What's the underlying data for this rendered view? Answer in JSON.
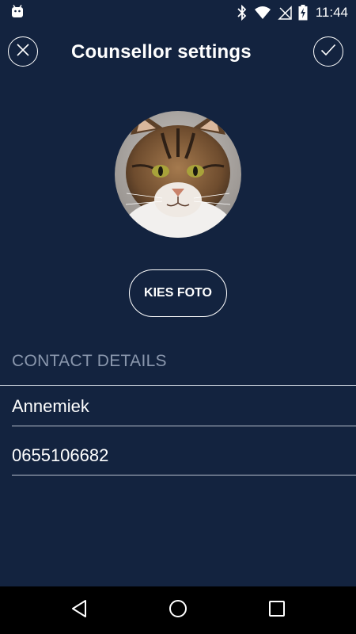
{
  "status_bar": {
    "time": "11:44",
    "icons": [
      "android-icon",
      "bluetooth-icon",
      "wifi-icon",
      "no-sim-icon",
      "battery-charging-icon"
    ]
  },
  "header": {
    "title": "Counsellor settings",
    "close_icon": "close-icon",
    "confirm_icon": "checkmark-icon"
  },
  "profile": {
    "avatar": "cat-photo",
    "pick_photo_label": "KIES FOTO"
  },
  "contact": {
    "section_title": "CONTACT DETAILS",
    "name_value": "Annemiek",
    "phone_value": "0655106682"
  },
  "nav_bar": {
    "icons": [
      "back-icon",
      "home-icon",
      "recents-icon"
    ]
  },
  "colors": {
    "background": "#13233f",
    "section_header": "#8a97ad",
    "divider": "#b7bfcc",
    "nav_bar": "#000000"
  }
}
